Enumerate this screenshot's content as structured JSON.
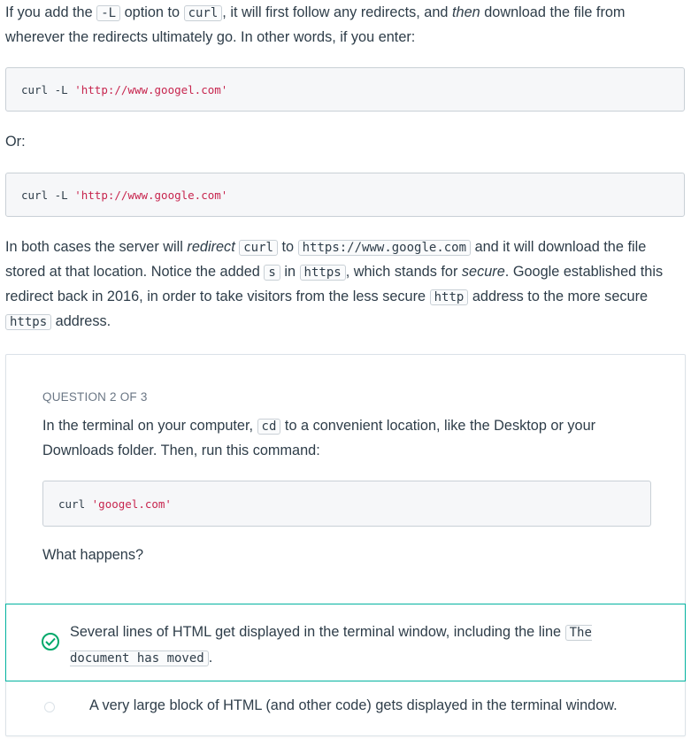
{
  "intro": {
    "p1_a": "If you add the ",
    "p1_code1": "-L",
    "p1_b": " option to ",
    "p1_code2": "curl",
    "p1_c": ", it will first follow any redirects, and ",
    "p1_em": "then",
    "p1_d": " download the file from wherever the redirects ultimately go. In other words, if you enter:"
  },
  "code1": {
    "cmd": "curl -L ",
    "str": "'http://www.googel.com'"
  },
  "or_text": "Or:",
  "code2": {
    "cmd": "curl -L ",
    "str": "'http://www.google.com'"
  },
  "p2": {
    "a": "In both cases the server will ",
    "em1": "redirect",
    "code1": "curl",
    "b": " to ",
    "code2": "https://www.google.com",
    "c": " and it will download the file stored at that location. Notice the added ",
    "code3": "s",
    "d": " in ",
    "code4": "https",
    "e": ", which stands for ",
    "em2": "secure",
    "f": ". Google established this redirect back in 2016, in order to take visitors from the less secure ",
    "code5": "http",
    "g": " address to the more secure ",
    "code6": "https",
    "h": " address."
  },
  "quiz": {
    "label": "QUESTION 2 OF 3",
    "text_a": "In the terminal on your computer, ",
    "text_code": "cd",
    "text_b": " to a convenient location, like the Desktop or your Downloads folder. Then, run this command:",
    "code": {
      "cmd": "curl ",
      "str": "'googel.com'"
    },
    "prompt": "What happens?",
    "answers": [
      {
        "text": "Several lines of HTML get displayed in the terminal window, including the line ",
        "code": "The document has moved",
        "tail": ".",
        "correct": true
      },
      {
        "text": "A very large block of HTML (and other code) gets displayed in the terminal window.",
        "correct": false
      }
    ]
  },
  "colors": {
    "correct": "#02b3a0",
    "check": "#02a86a",
    "string": "#c7254e"
  }
}
